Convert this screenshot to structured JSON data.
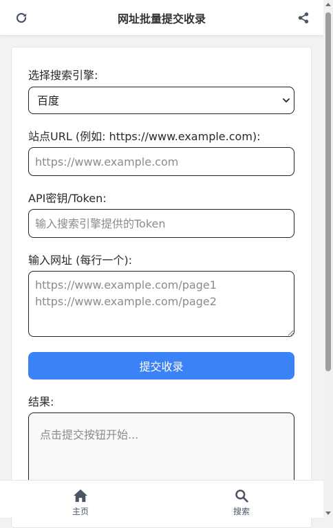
{
  "header": {
    "title": "网址批量提交收录",
    "refresh_icon": "refresh-icon",
    "share_icon": "share-icon"
  },
  "form": {
    "engine_label": "选择搜索引擎:",
    "engine_selected": "百度",
    "site_label": "站点URL (例如: https://www.example.com):",
    "site_placeholder": "https://www.example.com",
    "token_label": "API密钥/Token:",
    "token_placeholder": "输入搜索引擎提供的Token",
    "urls_label": "输入网址 (每行一个):",
    "urls_placeholder": "https://www.example.com/page1\nhttps://www.example.com/page2",
    "submit_label": "提交收录",
    "result_label": "结果:",
    "result_placeholder": "点击提交按钮开始..."
  },
  "nav": {
    "items": [
      {
        "label": "主页",
        "icon": "home-icon"
      },
      {
        "label": "搜索",
        "icon": "search-icon"
      }
    ]
  },
  "colors": {
    "accent": "#3b82f6",
    "icon": "#4a5568"
  }
}
